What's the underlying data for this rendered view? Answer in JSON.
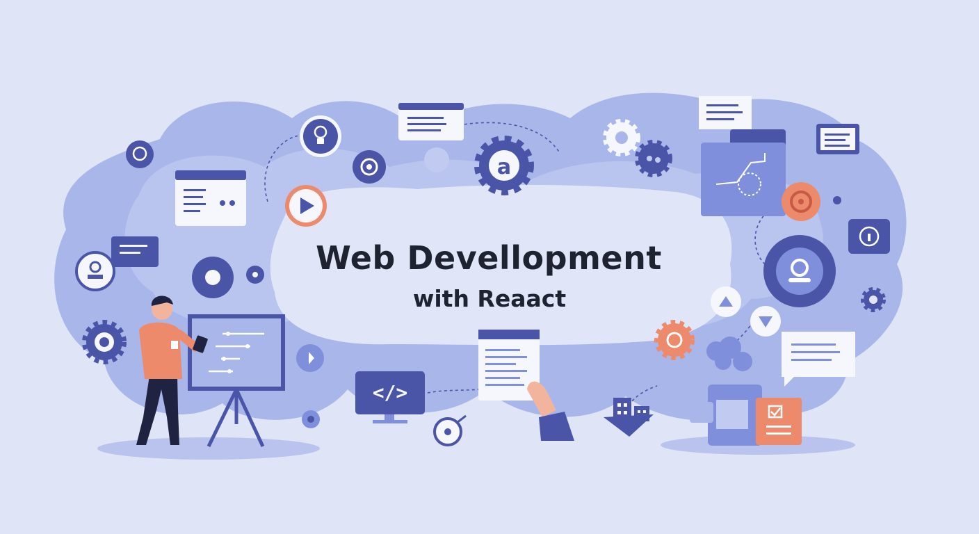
{
  "title": "Web Devellopment",
  "subtitle": "with Reaact",
  "monitor_symbol": "</>",
  "colors": {
    "background": "#dfe5f6",
    "blob": "#a9b6ea",
    "blob_light": "#c4cdf1",
    "indigo": "#4a55a8",
    "orange": "#ee8a6c",
    "white": "#f6f7fc",
    "text": "#1f2230"
  },
  "icons": [
    "chat-bubble-icon",
    "browser-window-icon",
    "lightbulb-icon",
    "play-button-icon",
    "eye-icon",
    "gear-icon",
    "at-sign-gear-icon",
    "chart-window-icon",
    "target-icon",
    "info-icon",
    "user-profile-icon",
    "arrow-up-icon",
    "arrow-down-icon",
    "code-monitor-icon",
    "document-icon",
    "clipboard-check-icon",
    "buildings-icon",
    "cloud-icon",
    "whiteboard-icon",
    "person-icon"
  ]
}
